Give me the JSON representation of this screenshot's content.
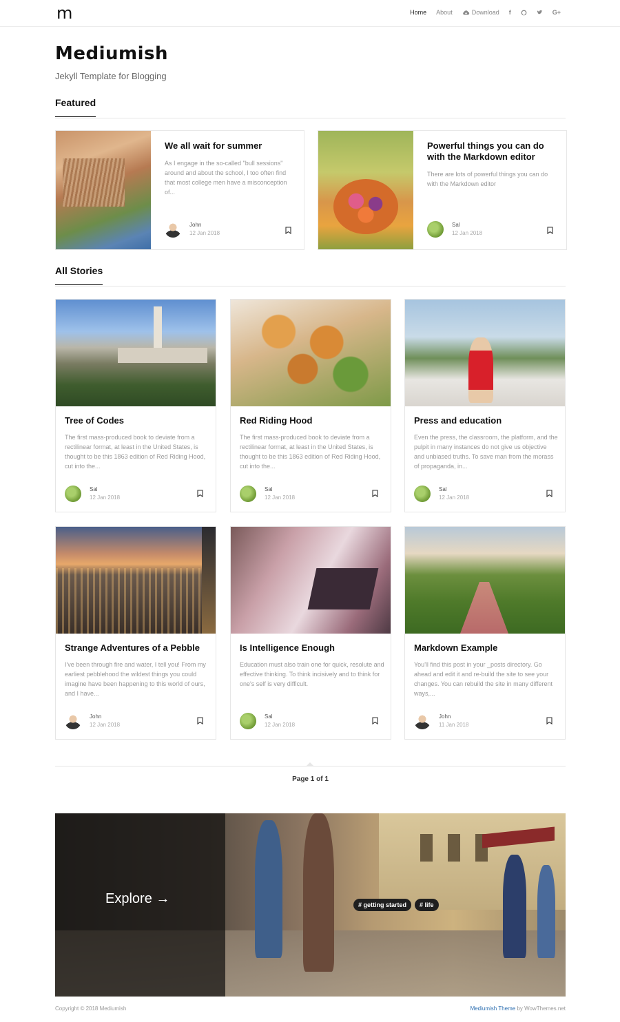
{
  "nav": {
    "logo": "m",
    "links": [
      {
        "label": "Home",
        "active": true
      },
      {
        "label": "About",
        "active": false
      },
      {
        "label": "Download",
        "active": false
      }
    ],
    "social_icons": [
      "facebook-icon",
      "github-icon",
      "twitter-icon",
      "google-plus-icon"
    ],
    "social_labels": [
      "f",
      "G+"
    ]
  },
  "site": {
    "title": "Mediumish",
    "subtitle": "Jekyll Template for Blogging"
  },
  "featured": {
    "heading": "Featured",
    "posts": [
      {
        "title": "We all wait for summer",
        "excerpt": "As I engage in the so-called \"bull sessions\" around and about the school, I too often find that most college men have a misconception of...",
        "author": "John",
        "date": "12 Jan 2018",
        "avatar": "john"
      },
      {
        "title": "Powerful things you can do with the Markdown editor",
        "excerpt": "There are lots of powerful things you can do with the Markdown editor",
        "author": "Sal",
        "date": "12 Jan 2018",
        "avatar": "sal"
      }
    ]
  },
  "all_stories": {
    "heading": "All Stories",
    "posts": [
      {
        "title": "Tree of Codes",
        "excerpt": "The first mass-produced book to deviate from a rectilinear format, at least in the United States, is thought to be this 1863 edition of Red Riding Hood, cut into the...",
        "author": "Sal",
        "date": "12 Jan 2018"
      },
      {
        "title": "Red Riding Hood",
        "excerpt": "The first mass-produced book to deviate from a rectilinear format, at least in the United States, is thought to be this 1863 edition of Red Riding Hood, cut into the...",
        "author": "Sal",
        "date": "12 Jan 2018"
      },
      {
        "title": "Press and education",
        "excerpt": "Even the press, the classroom, the platform, and the pulpit in many instances do not give us objective and unbiased truths. To save man from the morass of propaganda, in...",
        "author": "Sal",
        "date": "12 Jan 2018"
      },
      {
        "title": "Strange Adventures of a Pebble",
        "excerpt": "I've been through fire and water, I tell you! From my earliest pebblehood the wildest things you could imagine have been happening to this world of ours, and I have...",
        "author": "John",
        "date": "12 Jan 2018"
      },
      {
        "title": "Is Intelligence Enough",
        "excerpt": "Education must also train one for quick, resolute and effective thinking. To think incisively and to think for one's self is very difficult.",
        "author": "Sal",
        "date": "12 Jan 2018"
      },
      {
        "title": "Markdown Example",
        "excerpt": "You'll find this post in your _posts directory. Go ahead and edit it and re-build the site to see your changes. You can rebuild the site in many different ways,...",
        "author": "John",
        "date": "11 Jan 2018"
      }
    ]
  },
  "pagination": {
    "text": "Page 1 of 1"
  },
  "explore": {
    "label": "Explore →",
    "tags": [
      "# getting started",
      "# life"
    ]
  },
  "footer": {
    "copyright": "Copyright © 2018 Mediumish",
    "theme": "Mediumish Theme",
    "by": " by WowThemes.net"
  }
}
